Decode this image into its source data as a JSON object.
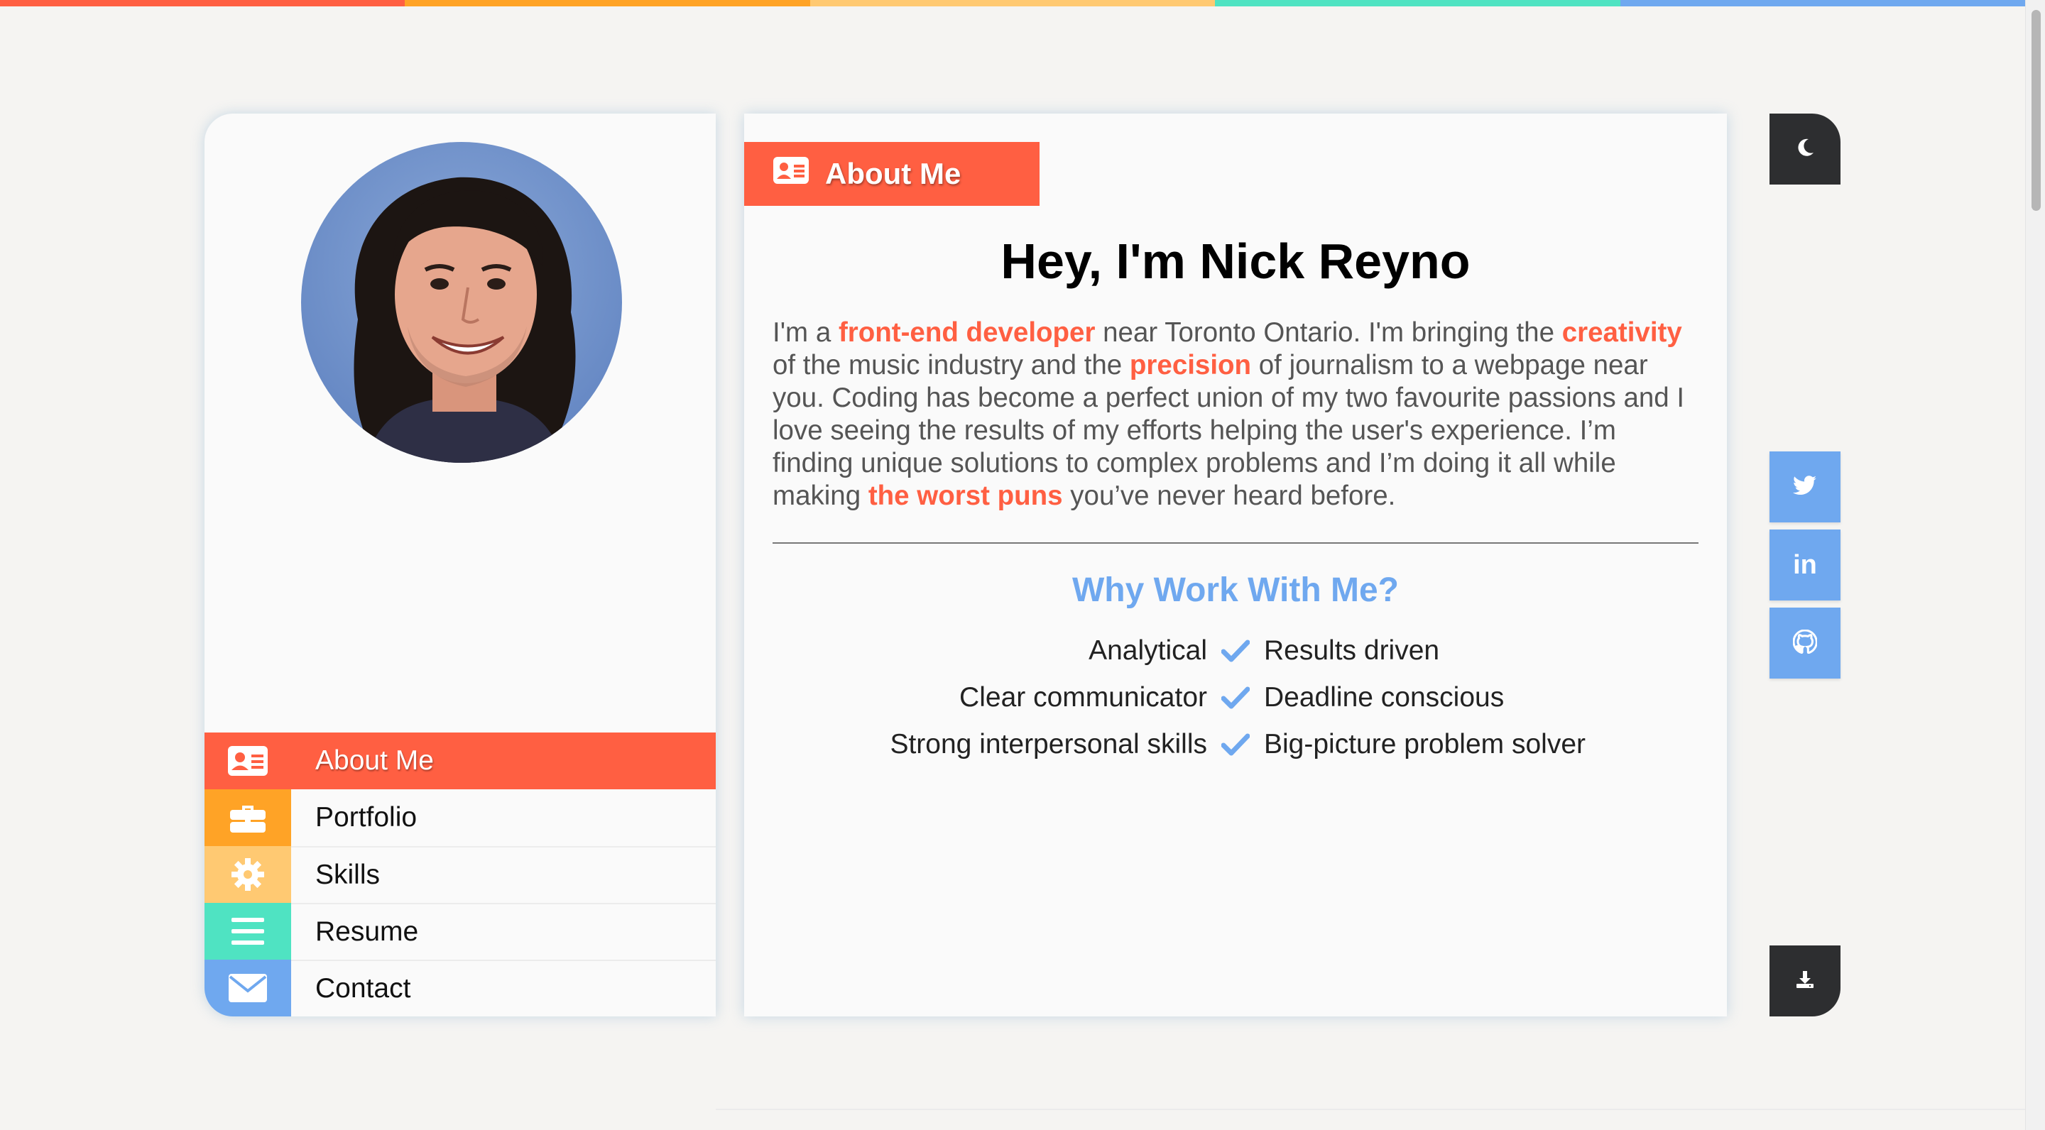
{
  "colors": {
    "stripe": [
      "#ff5f42",
      "#ffa326",
      "#ffc972",
      "#4fe3c2",
      "#6fa8ef"
    ],
    "accent": "#ff5f42",
    "blue": "#6fa8ef",
    "dark_button": "#2d2e30"
  },
  "sidebar": {
    "avatar_icon": "profile-photo",
    "nav": [
      {
        "label": "About Me",
        "icon": "id-card-icon",
        "color": "#ff5f42",
        "active": true
      },
      {
        "label": "Portfolio",
        "icon": "briefcase-icon",
        "color": "#ffa326",
        "active": false
      },
      {
        "label": "Skills",
        "icon": "gear-icon",
        "color": "#ffc972",
        "active": false
      },
      {
        "label": "Resume",
        "icon": "list-icon",
        "color": "#4fe3c2",
        "active": false
      },
      {
        "label": "Contact",
        "icon": "envelope-icon",
        "color": "#6fa8ef",
        "active": false
      }
    ]
  },
  "main": {
    "tab_label": "About Me",
    "tab_icon": "id-card-icon",
    "headline": "Hey, I'm Nick Reyno",
    "bio": [
      {
        "text": "I'm a ",
        "hl": false
      },
      {
        "text": "front-end developer",
        "hl": true
      },
      {
        "text": " near Toronto Ontario. I'm bringing the ",
        "hl": false
      },
      {
        "text": "creativity",
        "hl": true
      },
      {
        "text": " of the music industry and the ",
        "hl": false
      },
      {
        "text": "precision",
        "hl": true
      },
      {
        "text": " of journalism to a webpage near you. Coding has become a perfect union of my two favourite passions and I love seeing the results of my efforts helping the user's experience. I’m finding unique solutions to complex problems and I’m doing it all while making ",
        "hl": false
      },
      {
        "text": "the worst puns",
        "hl": true
      },
      {
        "text": " you’ve never heard before.",
        "hl": false
      }
    ],
    "why_title": "Why Work With Me?",
    "traits": [
      {
        "left": "Analytical",
        "right": "Results driven"
      },
      {
        "left": "Clear communicator",
        "right": "Deadline conscious"
      },
      {
        "left": "Strong interpersonal skills",
        "right": "Big-picture problem solver"
      }
    ]
  },
  "side_buttons": {
    "theme_icon": "moon-icon",
    "download_icon": "download-icon",
    "social": [
      {
        "name": "twitter",
        "icon": "twitter-icon"
      },
      {
        "name": "linkedin",
        "icon": "linkedin-icon",
        "text": "in"
      },
      {
        "name": "github",
        "icon": "github-icon"
      }
    ]
  }
}
